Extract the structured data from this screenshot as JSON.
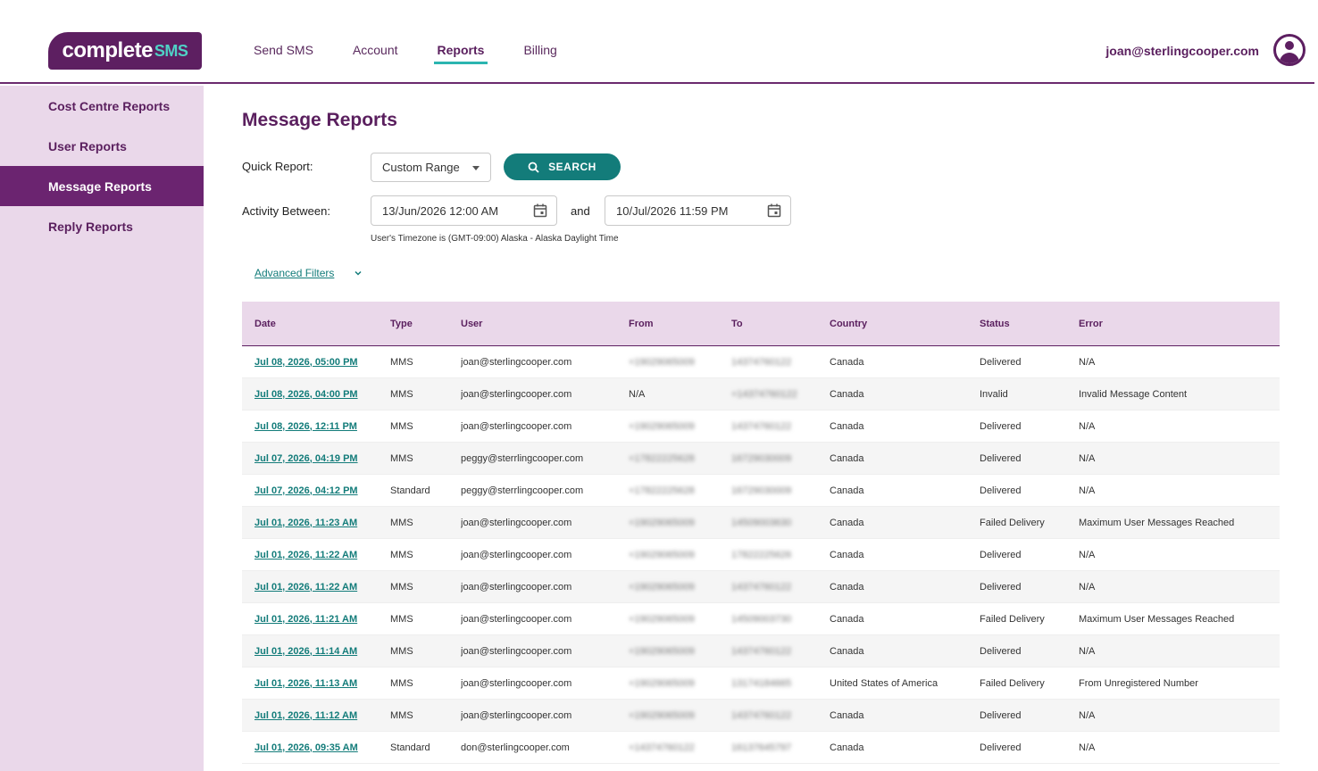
{
  "header": {
    "logo_main": "complete",
    "logo_accent": "SMS",
    "nav": [
      {
        "label": "Send SMS"
      },
      {
        "label": "Account"
      },
      {
        "label": "Reports"
      },
      {
        "label": "Billing"
      }
    ],
    "active_nav": "Reports",
    "user_email": "joan@sterlingcooper.com"
  },
  "sidebar": {
    "items": [
      {
        "label": "Cost Centre Reports"
      },
      {
        "label": "User Reports"
      },
      {
        "label": "Message Reports"
      },
      {
        "label": "Reply Reports"
      }
    ],
    "active": "Message Reports"
  },
  "main": {
    "title": "Message Reports",
    "quick_report_label": "Quick Report:",
    "quick_report_value": "Custom Range",
    "search_label": "SEARCH",
    "activity_label": "Activity Between:",
    "date_from": "13/Jun/2026 12:00 AM",
    "and_label": "and",
    "date_to": "10/Jul/2026 11:59 PM",
    "timezone_note": "User's Timezone is (GMT-09:00) Alaska - Alaska Daylight Time",
    "advanced_filters_label": "Advanced Filters"
  },
  "table": {
    "columns": [
      "Date",
      "Type",
      "User",
      "From",
      "To",
      "Country",
      "Status",
      "Error"
    ],
    "rows": [
      [
        "Jul 08, 2026, 05:00 PM",
        "MMS",
        "joan@sterlingcooper.com",
        "+19029065009",
        "14374760122",
        "Canada",
        "Delivered",
        "N/A"
      ],
      [
        "Jul 08, 2026, 04:00 PM",
        "MMS",
        "joan@sterlingcooper.com",
        "N/A",
        "+14374760122",
        "Canada",
        "Invalid",
        "Invalid Message Content"
      ],
      [
        "Jul 08, 2026, 12:11 PM",
        "MMS",
        "joan@sterlingcooper.com",
        "+19029065009",
        "14374760122",
        "Canada",
        "Delivered",
        "N/A"
      ],
      [
        "Jul 07, 2026, 04:19 PM",
        "MMS",
        "peggy@sterrlingcooper.com",
        "+17822225628",
        "16729030009",
        "Canada",
        "Delivered",
        "N/A"
      ],
      [
        "Jul 07, 2026, 04:12 PM",
        "Standard",
        "peggy@sterrlingcooper.com",
        "+17822225628",
        "16729030009",
        "Canada",
        "Delivered",
        "N/A"
      ],
      [
        "Jul 01, 2026, 11:23 AM",
        "MMS",
        "joan@sterlingcooper.com",
        "+19029065009",
        "14509003630",
        "Canada",
        "Failed Delivery",
        "Maximum User Messages Reached"
      ],
      [
        "Jul 01, 2026, 11:22 AM",
        "MMS",
        "joan@sterlingcooper.com",
        "+19029065009",
        "17822225626",
        "Canada",
        "Delivered",
        "N/A"
      ],
      [
        "Jul 01, 2026, 11:22 AM",
        "MMS",
        "joan@sterlingcooper.com",
        "+19029065009",
        "14374760122",
        "Canada",
        "Delivered",
        "N/A"
      ],
      [
        "Jul 01, 2026, 11:21 AM",
        "MMS",
        "joan@sterlingcooper.com",
        "+19029065009",
        "14509003730",
        "Canada",
        "Failed Delivery",
        "Maximum User Messages Reached"
      ],
      [
        "Jul 01, 2026, 11:14 AM",
        "MMS",
        "joan@sterlingcooper.com",
        "+19029065009",
        "14374760122",
        "Canada",
        "Delivered",
        "N/A"
      ],
      [
        "Jul 01, 2026, 11:13 AM",
        "MMS",
        "joan@sterlingcooper.com",
        "+19029065009",
        "13174184665",
        "United States of America",
        "Failed Delivery",
        "From Unregistered Number"
      ],
      [
        "Jul 01, 2026, 11:12 AM",
        "MMS",
        "joan@sterlingcooper.com",
        "+19029065009",
        "14374760122",
        "Canada",
        "Delivered",
        "N/A"
      ],
      [
        "Jul 01, 2026, 09:35 AM",
        "Standard",
        "don@sterlingcooper.com",
        "+14374760122",
        "16137645797",
        "Canada",
        "Delivered",
        "N/A"
      ]
    ]
  },
  "colors": {
    "brand_purple": "#5d1f61",
    "accent_teal": "#137c7a",
    "sidebar_bg": "#ead8ea"
  }
}
